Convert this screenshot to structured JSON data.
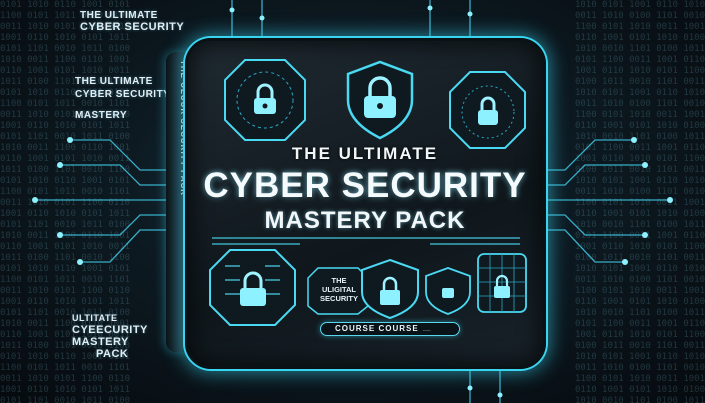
{
  "top_left_text": {
    "line1": "THE ULTIMATE",
    "line2": "CYBER SECURITY"
  },
  "mid_left_text": {
    "line1": "THE ULTIMATE",
    "line2": "CYBER SECURITY",
    "line3": "MASTERY"
  },
  "bottom_left_text": {
    "line1": "ULTITATE",
    "line2": "CYEECURITY",
    "line3": "MASTERY",
    "line4": "PACK"
  },
  "spine_text": "THE ULUUR SECURITY PACK",
  "title": {
    "line1": "THE ULTIMATE",
    "line2": "CYBER SECURITY",
    "line3": "MASTERY PACK"
  },
  "badge": {
    "line1": "THE",
    "line2": "ULIGITAL",
    "line3": "SECURITY"
  },
  "course_bar": {
    "label": "COURSE COURSE",
    "small": "------"
  },
  "colors": {
    "accent": "#38d4f0",
    "background": "#0d1a22",
    "card": "#141e24"
  },
  "icons": [
    "padlock-icon",
    "shield-icon",
    "circuit-chip-icon",
    "grid-icon"
  ]
}
